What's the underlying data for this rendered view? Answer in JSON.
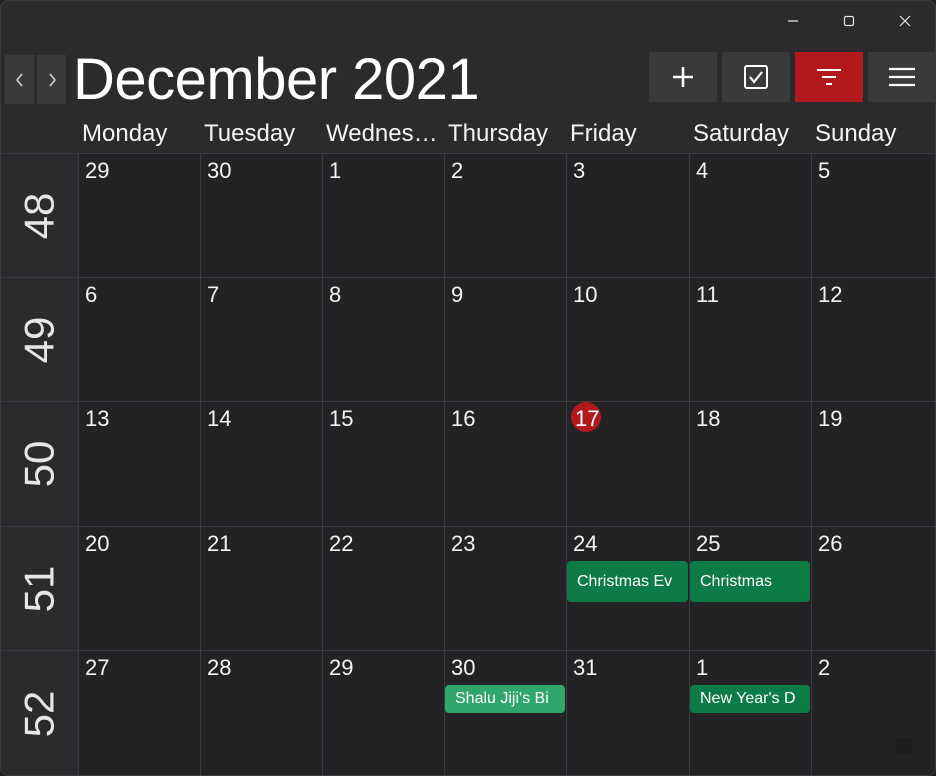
{
  "header": {
    "month_title": "December 2021"
  },
  "nav": {
    "prev": "‹",
    "next": "›"
  },
  "toolbar": {
    "add_icon": "plus-icon",
    "task_icon": "checkbox-icon",
    "filter_icon": "filter-icon",
    "menu_icon": "hamburger-menu-icon"
  },
  "colors": {
    "filter_active": "#b2191d",
    "today": "#b2191d",
    "event_green": "#0c7b45",
    "event_light_green": "#2fa66b"
  },
  "day_headers": [
    "Monday",
    "Tuesday",
    "Wednes…",
    "Thursday",
    "Friday",
    "Saturday",
    "Sunday"
  ],
  "weeks": [
    {
      "week": "48",
      "days": [
        "29",
        "30",
        "1",
        "2",
        "3",
        "4",
        "5"
      ]
    },
    {
      "week": "49",
      "days": [
        "6",
        "7",
        "8",
        "9",
        "10",
        "11",
        "12"
      ]
    },
    {
      "week": "50",
      "days": [
        "13",
        "14",
        "15",
        "16",
        "17",
        "18",
        "19"
      ]
    },
    {
      "week": "51",
      "days": [
        "20",
        "21",
        "22",
        "23",
        "24",
        "25",
        "26"
      ]
    },
    {
      "week": "52",
      "days": [
        "27",
        "28",
        "29",
        "30",
        "31",
        "1",
        "2"
      ]
    }
  ],
  "today": {
    "week": 2,
    "day": 4
  },
  "events": [
    {
      "title": "Christmas Ev",
      "week": 3,
      "day": 4,
      "color": "#0c7b45"
    },
    {
      "title": "Christmas",
      "week": 3,
      "day": 5,
      "color": "#0c7b45"
    },
    {
      "title": "Shalu Jiji's Bi",
      "week": 4,
      "day": 3,
      "color": "#2fa66b"
    },
    {
      "title": "New Year's D",
      "week": 4,
      "day": 5,
      "color": "#0c7b45"
    }
  ]
}
